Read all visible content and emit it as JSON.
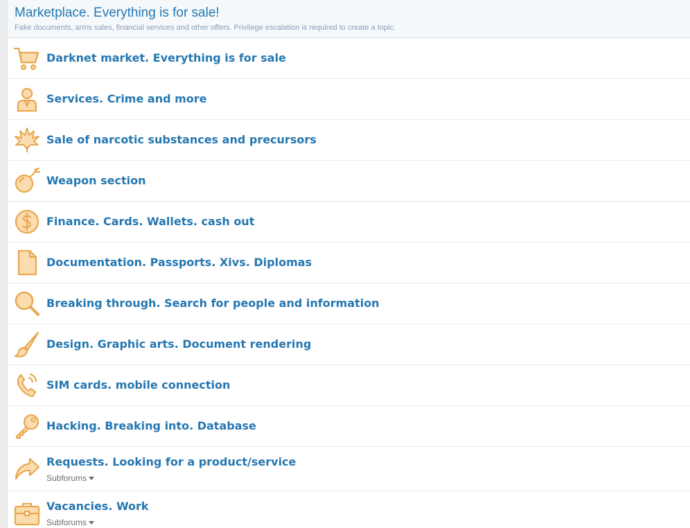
{
  "category": {
    "title": "Marketplace. Everything is for sale!",
    "description": "Fake documents, arms sales, financial services and other offers. Privilege escalation is required to create a topic."
  },
  "colors": {
    "accent": "#2577b1",
    "icon_stroke": "#e8a850",
    "icon_fill": "#fbdcae"
  },
  "forums": [
    {
      "title": "Darknet market. Everything is for sale",
      "icon": "cart-icon"
    },
    {
      "title": "Services. Crime and more",
      "icon": "person-icon"
    },
    {
      "title": "Sale of narcotic substances and precursors",
      "icon": "leaf-icon"
    },
    {
      "title": "Weapon section",
      "icon": "bomb-icon"
    },
    {
      "title": "Finance. Cards. Wallets. cash out",
      "icon": "dollar-icon"
    },
    {
      "title": "Documentation. Passports. Xivs. Diplomas",
      "icon": "document-icon"
    },
    {
      "title": "Breaking through. Search for people and information",
      "icon": "search-icon"
    },
    {
      "title": "Design. Graphic arts. Document rendering",
      "icon": "brush-icon"
    },
    {
      "title": "SIM cards. mobile connection",
      "icon": "phone-icon"
    },
    {
      "title": "Hacking. Breaking into. Database",
      "icon": "key-icon"
    },
    {
      "title": "Requests. Looking for a product/service",
      "icon": "share-arrow-icon",
      "subforums_label": "Subforums"
    },
    {
      "title": "Vacancies. Work",
      "icon": "briefcase-icon",
      "subforums_label": "Subforums"
    }
  ]
}
